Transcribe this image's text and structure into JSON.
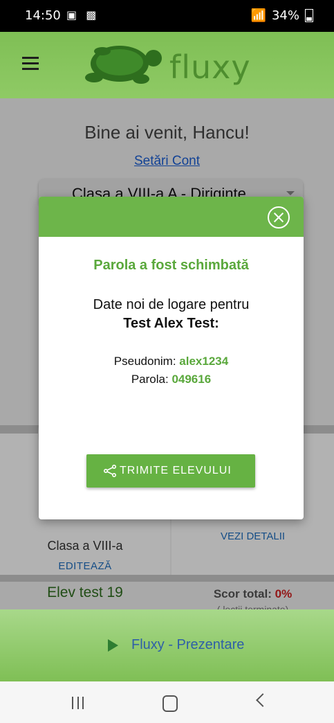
{
  "status": {
    "time": "14:50",
    "battery": "34%",
    "network": "LTE"
  },
  "header": {
    "app_name": "fluxy"
  },
  "page": {
    "welcome": "Bine ai venit, Hancu!",
    "settings_link": "Setări Cont",
    "class_select": "Clasa a VIII-a A - Diriginte"
  },
  "cards": {
    "student_class": "Clasa a VIII-a",
    "edit_label": "EDITEAZĂ",
    "details_label": "VEZI DETALII",
    "student_name": "Elev test 19",
    "score_label": "Scor total:",
    "score_value": "0%",
    "score_sub": "( lecții terminate)"
  },
  "modal": {
    "title": "Parola a fost schimbată",
    "text": "Date noi de logare pentru",
    "student": "Test Alex Test:",
    "username_label": "Pseudonim:",
    "username": "alex1234",
    "password_label": "Parola:",
    "password": "049616",
    "send_button": "TRIMITE ELEVULUI"
  },
  "footer": {
    "presentation_link": "Fluxy - Prezentare"
  },
  "colors": {
    "brand_green": "#6db54a",
    "link_blue": "#1a5fd6",
    "score_red": "#d32222"
  }
}
